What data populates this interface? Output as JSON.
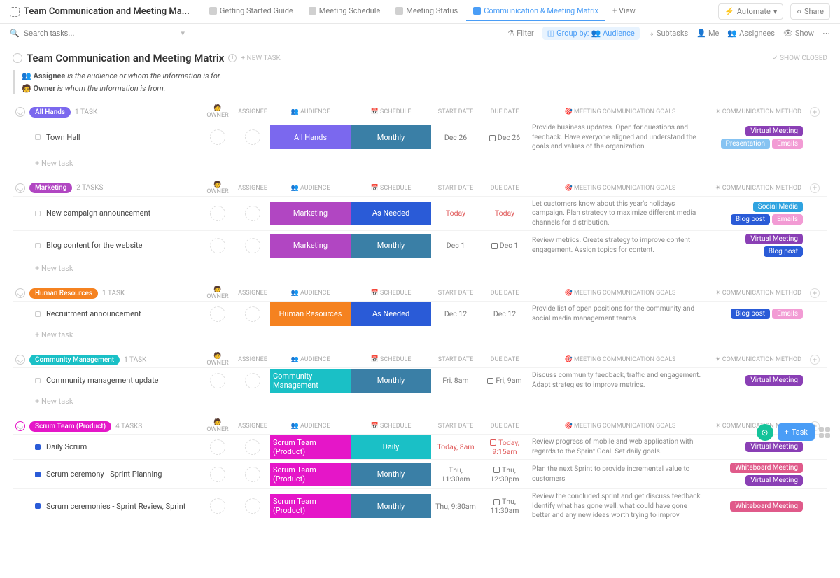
{
  "header": {
    "title": "Team Communication and Meeting Ma...",
    "tabs": [
      {
        "label": "Getting Started Guide",
        "active": false
      },
      {
        "label": "Meeting Schedule",
        "active": false
      },
      {
        "label": "Meeting Status",
        "active": false
      },
      {
        "label": "Communication & Meeting Matrix",
        "active": true
      }
    ],
    "add_view": "+ View",
    "automate": "Automate",
    "share": "Share"
  },
  "toolbar": {
    "search_placeholder": "Search tasks...",
    "filter": "Filter",
    "group_by_label": "Group by:",
    "group_by_value": "Audience",
    "subtasks": "Subtasks",
    "me": "Me",
    "assignees": "Assignees",
    "show": "Show"
  },
  "page": {
    "title": "Team Communication and Meeting Matrix",
    "new_task": "+ NEW TASK",
    "show_closed": "SHOW CLOSED",
    "desc_assignee_label": "Assignee",
    "desc_assignee_text": " is the audience or whom the information is for.",
    "desc_owner_label": "Owner",
    "desc_owner_text": " is whom the information is from."
  },
  "columns": {
    "owner": "OWNER",
    "assignee": "ASSIGNEE",
    "audience": "AUDIENCE",
    "schedule": "SCHEDULE",
    "start": "START DATE",
    "due": "DUE DATE",
    "goals": "MEETING COMMUNICATION GOALS",
    "method": "COMMUNICATION METHOD"
  },
  "new_task_label": "+ New task",
  "fab": {
    "task": "Task"
  },
  "colors": {
    "virtual_meeting": "#8a3fb5",
    "presentation": "#86c3f2",
    "emails": "#f29bd4",
    "social_media": "#2fa3e0",
    "blog_post": "#2a5bd7",
    "whiteboard": "#e05a8a"
  },
  "groups": [
    {
      "name": "All Hands",
      "count": "1 TASK",
      "color": "#7b68ee",
      "rows": [
        {
          "name": "Town Hall",
          "sq": "#ccc",
          "aud": "All Hands",
          "aud_color": "#7b68ee",
          "sch": "Monthly",
          "sch_color": "#3a7fa6",
          "start": "Dec 26",
          "due": "Dec 26",
          "due_icon": true,
          "goals": "Provide business updates. Open for questions and feedback. Have everyone aligned and understand the goals and values of the organization.",
          "methods": [
            [
              "Virtual Meeting",
              "#8a3fb5"
            ],
            [
              "Presentation",
              "#86c3f2"
            ],
            [
              "Emails",
              "#f29bd4"
            ]
          ]
        }
      ]
    },
    {
      "name": "Marketing",
      "count": "2 TASKS",
      "color": "#b146c2",
      "rows": [
        {
          "name": "New campaign announcement",
          "sq": "#ccc",
          "aud": "Marketing",
          "aud_color": "#b146c2",
          "sch": "As Needed",
          "sch_color": "#2a5bd7",
          "start": "Today",
          "start_red": true,
          "due": "Today",
          "due_red": true,
          "goals": "Let customers know about this year's holidays campaign. Plan strategy to maximize different media channels for distribution.",
          "methods": [
            [
              "Social Media",
              "#2fa3e0"
            ],
            [
              "Blog post",
              "#2a5bd7"
            ],
            [
              "Emails",
              "#f29bd4"
            ]
          ]
        },
        {
          "name": "Blog content for the website",
          "sq": "#ccc",
          "aud": "Marketing",
          "aud_color": "#b146c2",
          "sch": "Monthly",
          "sch_color": "#3a7fa6",
          "start": "Dec 1",
          "due": "Dec 1",
          "due_icon": true,
          "goals": "Review metrics. Create strategy to improve content engagement. Assign topics for content.",
          "methods": [
            [
              "Virtual Meeting",
              "#8a3fb5"
            ],
            [
              "Blog post",
              "#2a5bd7"
            ]
          ]
        }
      ]
    },
    {
      "name": "Human Resources",
      "count": "1 TASK",
      "color": "#f58220",
      "rows": [
        {
          "name": "Recruitment announcement",
          "sq": "#ccc",
          "aud": "Human Resources",
          "aud_color": "#f58220",
          "sch": "As Needed",
          "sch_color": "#2a5bd7",
          "start": "Dec 12",
          "due": "Dec 12",
          "goals": "Provide list of open positions for the community and social media management teams",
          "methods": [
            [
              "Blog post",
              "#2a5bd7"
            ],
            [
              "Emails",
              "#f29bd4"
            ]
          ]
        }
      ]
    },
    {
      "name": "Community Management",
      "count": "1 TASK",
      "color": "#1ac0c6",
      "rows": [
        {
          "name": "Community management update",
          "sq": "#ccc",
          "aud": "Community Management",
          "aud_color": "#1ac0c6",
          "sch": "Monthly",
          "sch_color": "#3a7fa6",
          "start": "Fri, 8am",
          "due": "Fri, 9am",
          "due_icon": true,
          "goals": "Discuss community feedback, traffic and engagement. Adapt strategies to improve metrics.",
          "methods": [
            [
              "Virtual Meeting",
              "#8a3fb5"
            ]
          ]
        }
      ]
    },
    {
      "name": "Scrum Team (Product)",
      "count": "4 TASKS",
      "color": "#e516c8",
      "open": true,
      "rows": [
        {
          "name": "Daily Scrum",
          "sq_fill": "#2a5bd7",
          "aud": "Scrum Team (Product)",
          "aud_color": "#e516c8",
          "sch": "Daily",
          "sch_color": "#1ac0c6",
          "start": "Today, 8am",
          "start_red": true,
          "due": "Today, 9:15am",
          "due_red": true,
          "due_icon": true,
          "goals": "Review progress of mobile and web application with regards to the Sprint Goal. Set daily goals.",
          "methods": [
            [
              "Virtual Meeting",
              "#8a3fb5"
            ]
          ]
        },
        {
          "name": "Scrum ceremony - Sprint Planning",
          "sq_fill": "#2a5bd7",
          "aud": "Scrum Team (Product)",
          "aud_color": "#e516c8",
          "sch": "Monthly",
          "sch_color": "#3a7fa6",
          "start": "Thu, 11:30am",
          "due": "Thu, 12:30pm",
          "due_icon": true,
          "goals": "Plan the next Sprint to provide incremental value to customers",
          "methods": [
            [
              "Whiteboard Meeting",
              "#e05a8a"
            ],
            [
              "Virtual Meeting",
              "#8a3fb5"
            ]
          ]
        },
        {
          "name": "Scrum ceremonies - Sprint Review, Sprint",
          "sq_fill": "#2a5bd7",
          "aud": "Scrum Team (Product)",
          "aud_color": "#e516c8",
          "sch": "Monthly",
          "sch_color": "#3a7fa6",
          "start": "Thu, 9:30am",
          "due": "Thu, 11:30am",
          "due_icon": true,
          "goals": "Review the concluded sprint and get discuss feedback. Identify what has gone well, what could have gone better and any new ideas worth trying to improv",
          "methods": [
            [
              "Whiteboard Meeting",
              "#e05a8a"
            ]
          ]
        }
      ]
    }
  ]
}
